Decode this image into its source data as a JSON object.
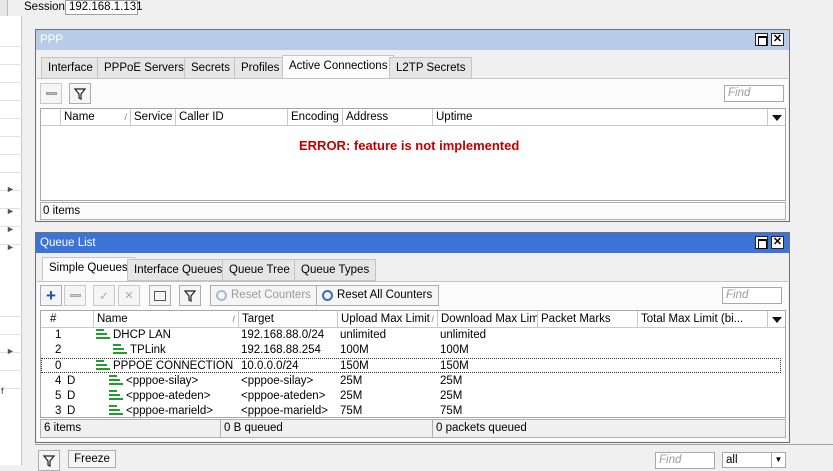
{
  "session": {
    "label": "Session:",
    "value": "192.168.1.131"
  },
  "ppp": {
    "title": "PPP",
    "tabs": [
      "Interface",
      "PPPoE Servers",
      "Secrets",
      "Profiles",
      "Active Connections",
      "L2TP Secrets"
    ],
    "active_tab": "Active Connections",
    "find_placeholder": "Find",
    "columns": [
      "Name",
      "Service",
      "Caller ID",
      "Encoding",
      "Address",
      "Uptime"
    ],
    "error": "ERROR: feature is not implemented",
    "status": "0 items"
  },
  "queue": {
    "title": "Queue List",
    "tabs": [
      "Simple Queues",
      "Interface Queues",
      "Queue Tree",
      "Queue Types"
    ],
    "active_tab": "Simple Queues",
    "reset_counters": "Reset Counters",
    "reset_all_counters": "Reset All Counters",
    "find_placeholder": "Find",
    "columns": [
      "#",
      "Name",
      "Target",
      "Upload Max Limit",
      "Download Max Limit",
      "Packet Marks",
      "Total Max Limit (bi..."
    ],
    "rows": [
      {
        "num": "1",
        "flag": "",
        "name": "DHCP LAN",
        "target": "192.168.88.0/24",
        "upload": "unlimited",
        "download": "unlimited"
      },
      {
        "num": "2",
        "flag": "",
        "name": "TPLink",
        "target": "192.168.88.254",
        "upload": "100M",
        "download": "100M"
      },
      {
        "num": "0",
        "flag": "",
        "name": "PPPOE CONNECTION",
        "target": "10.0.0.0/24",
        "upload": "150M",
        "download": "150M"
      },
      {
        "num": "4",
        "flag": "D",
        "name": "<pppoe-silay>",
        "target": "<pppoe-silay>",
        "upload": "25M",
        "download": "25M"
      },
      {
        "num": "5",
        "flag": "D",
        "name": "<pppoe-ateden>",
        "target": "<pppoe-ateden>",
        "upload": "25M",
        "download": "25M"
      },
      {
        "num": "3",
        "flag": "D",
        "name": "<pppoe-marield>",
        "target": "<pppoe-marield>",
        "upload": "75M",
        "download": "75M"
      }
    ],
    "status_items": "6 items",
    "status_queued": "0 B queued",
    "status_packets": "0 packets queued"
  },
  "bottom": {
    "freeze": "Freeze",
    "find_placeholder": "Find",
    "select_value": "all"
  },
  "colors": {
    "titlebar": "#3c73d6",
    "error": "#c00000",
    "queue_icon": "#1f9e2c",
    "add_icon": "#1f4fa0"
  }
}
